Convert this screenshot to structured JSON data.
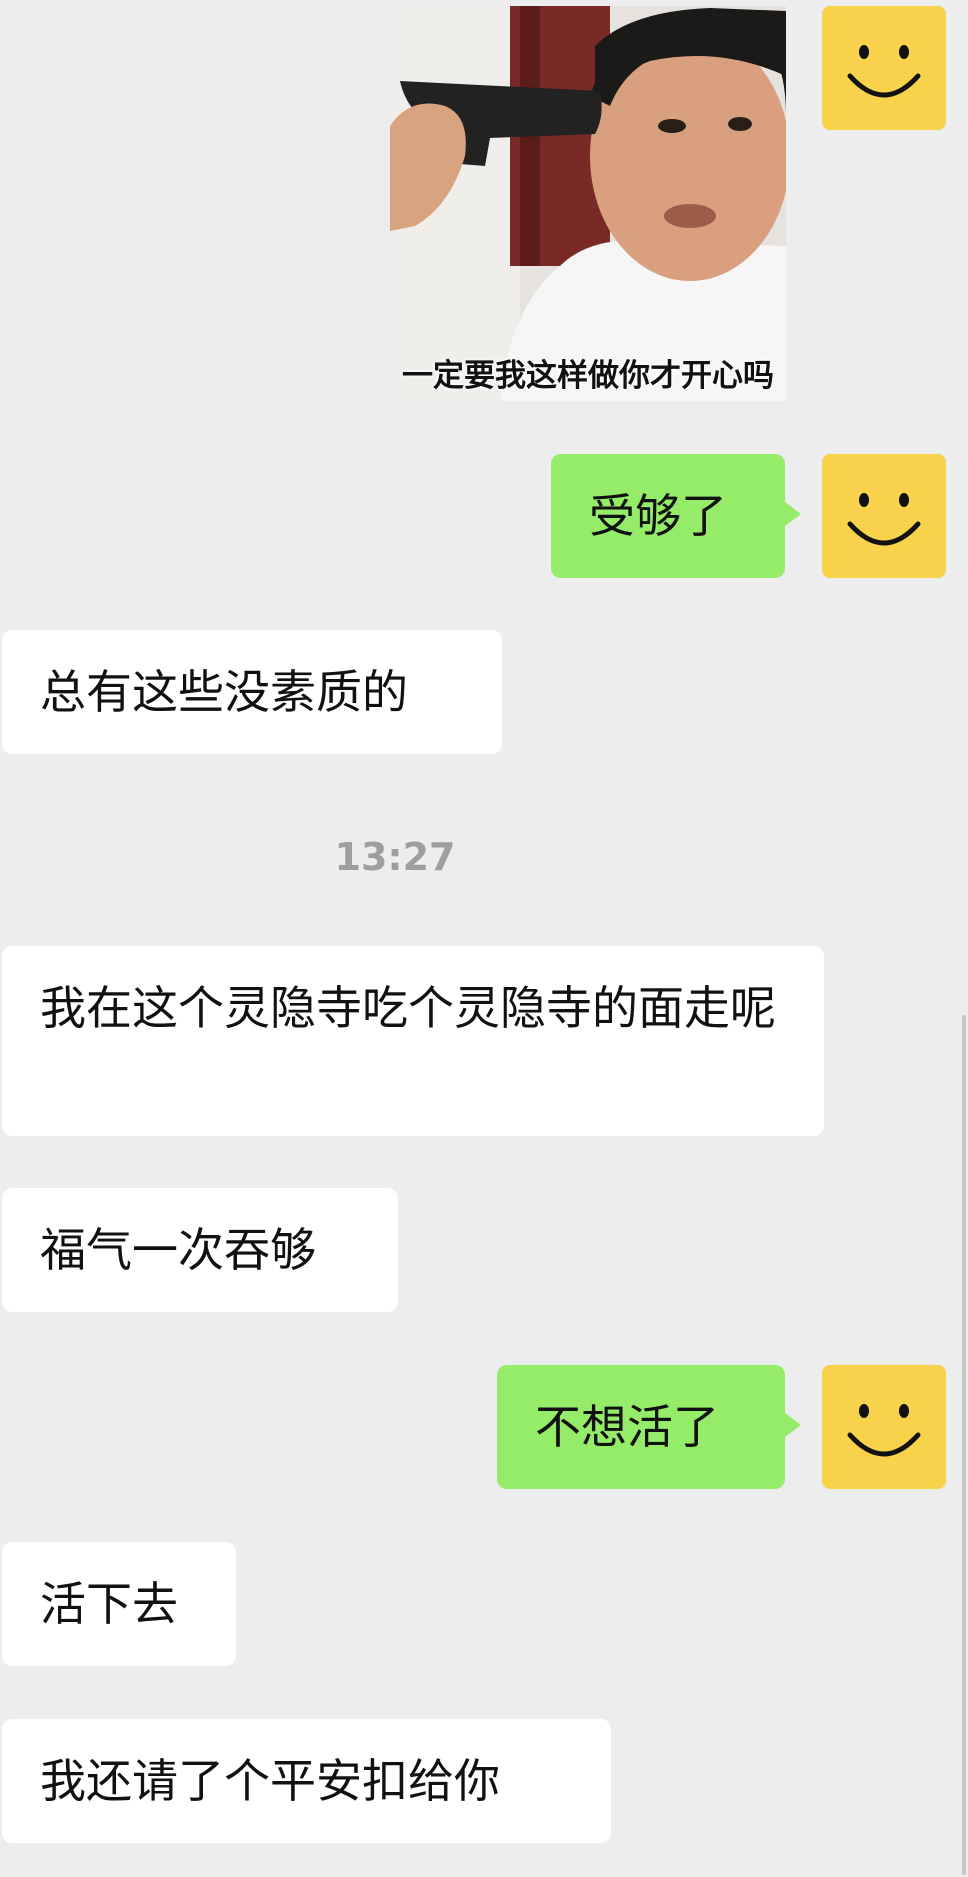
{
  "meme": {
    "caption": "一定要我这样做你才开心吗"
  },
  "messages": [
    {
      "text": "受够了"
    },
    {
      "text": "总有这些没素质的"
    },
    {
      "text": "我在这个灵隐寺吃个灵隐寺的面走呢"
    },
    {
      "text": "福气一次吞够"
    },
    {
      "text": "不想活了"
    },
    {
      "text": "活下去"
    },
    {
      "text": "我还请了个平安扣给你"
    }
  ],
  "timestamp": "13:27",
  "colors": {
    "background": "#ededed",
    "sent_bubble": "#95ec69",
    "received_bubble": "#ffffff",
    "avatar": "#f7d24a"
  },
  "icons": {
    "avatar": "smiley-face-icon"
  }
}
